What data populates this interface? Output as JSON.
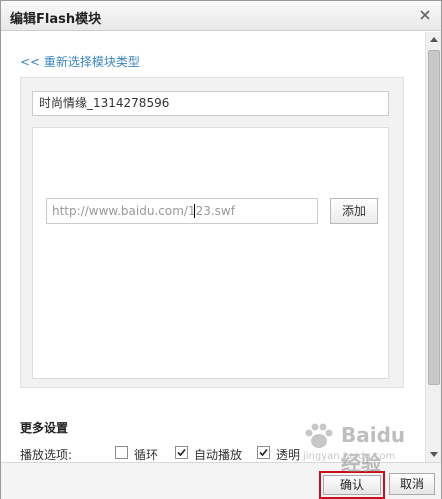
{
  "dialog": {
    "title": "编辑Flash模块",
    "close_icon": "close-icon"
  },
  "content": {
    "back_link": "<< 重新选择模块类型",
    "module_name_value": "时尚情缘_1314278596",
    "flash_url": {
      "value": "http://www.baidu.com/123.swf"
    },
    "add_button_label": "添加",
    "more_settings_title": "更多设置",
    "play_options": {
      "label": "播放选项:",
      "items": [
        {
          "label": "循环",
          "checked": false
        },
        {
          "label": "自动播放",
          "checked": true
        },
        {
          "label": "透明",
          "checked": true
        }
      ]
    }
  },
  "footer": {
    "confirm_label": "确认",
    "cancel_label": "取消",
    "highlight_color": "#c8101a"
  },
  "watermark": {
    "text": "Baidu经验",
    "url": "jingyan.baidu.com"
  }
}
